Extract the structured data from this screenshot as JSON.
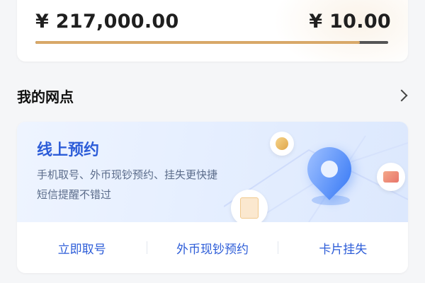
{
  "balance": {
    "left_amount": "¥ 217,000.00",
    "right_amount": "¥ 10.00",
    "progress_fraction": 0.92,
    "colors": {
      "fill": "#d8a868",
      "track": "#555555"
    }
  },
  "section": {
    "title": "我的网点"
  },
  "banner": {
    "title": "线上预约",
    "desc_line1": "手机取号、外币现钞预约、挂失更快捷",
    "desc_line2": "短信提醒不错过",
    "icons": [
      "coin-icon",
      "location-pin-icon",
      "bank-card-icon",
      "ticket-icon"
    ],
    "colors": {
      "accent": "#2d5dd8",
      "background": "#e6efff"
    }
  },
  "actions": [
    {
      "label": "立即取号"
    },
    {
      "label": "外币现钞预约"
    },
    {
      "label": "卡片挂失"
    }
  ]
}
